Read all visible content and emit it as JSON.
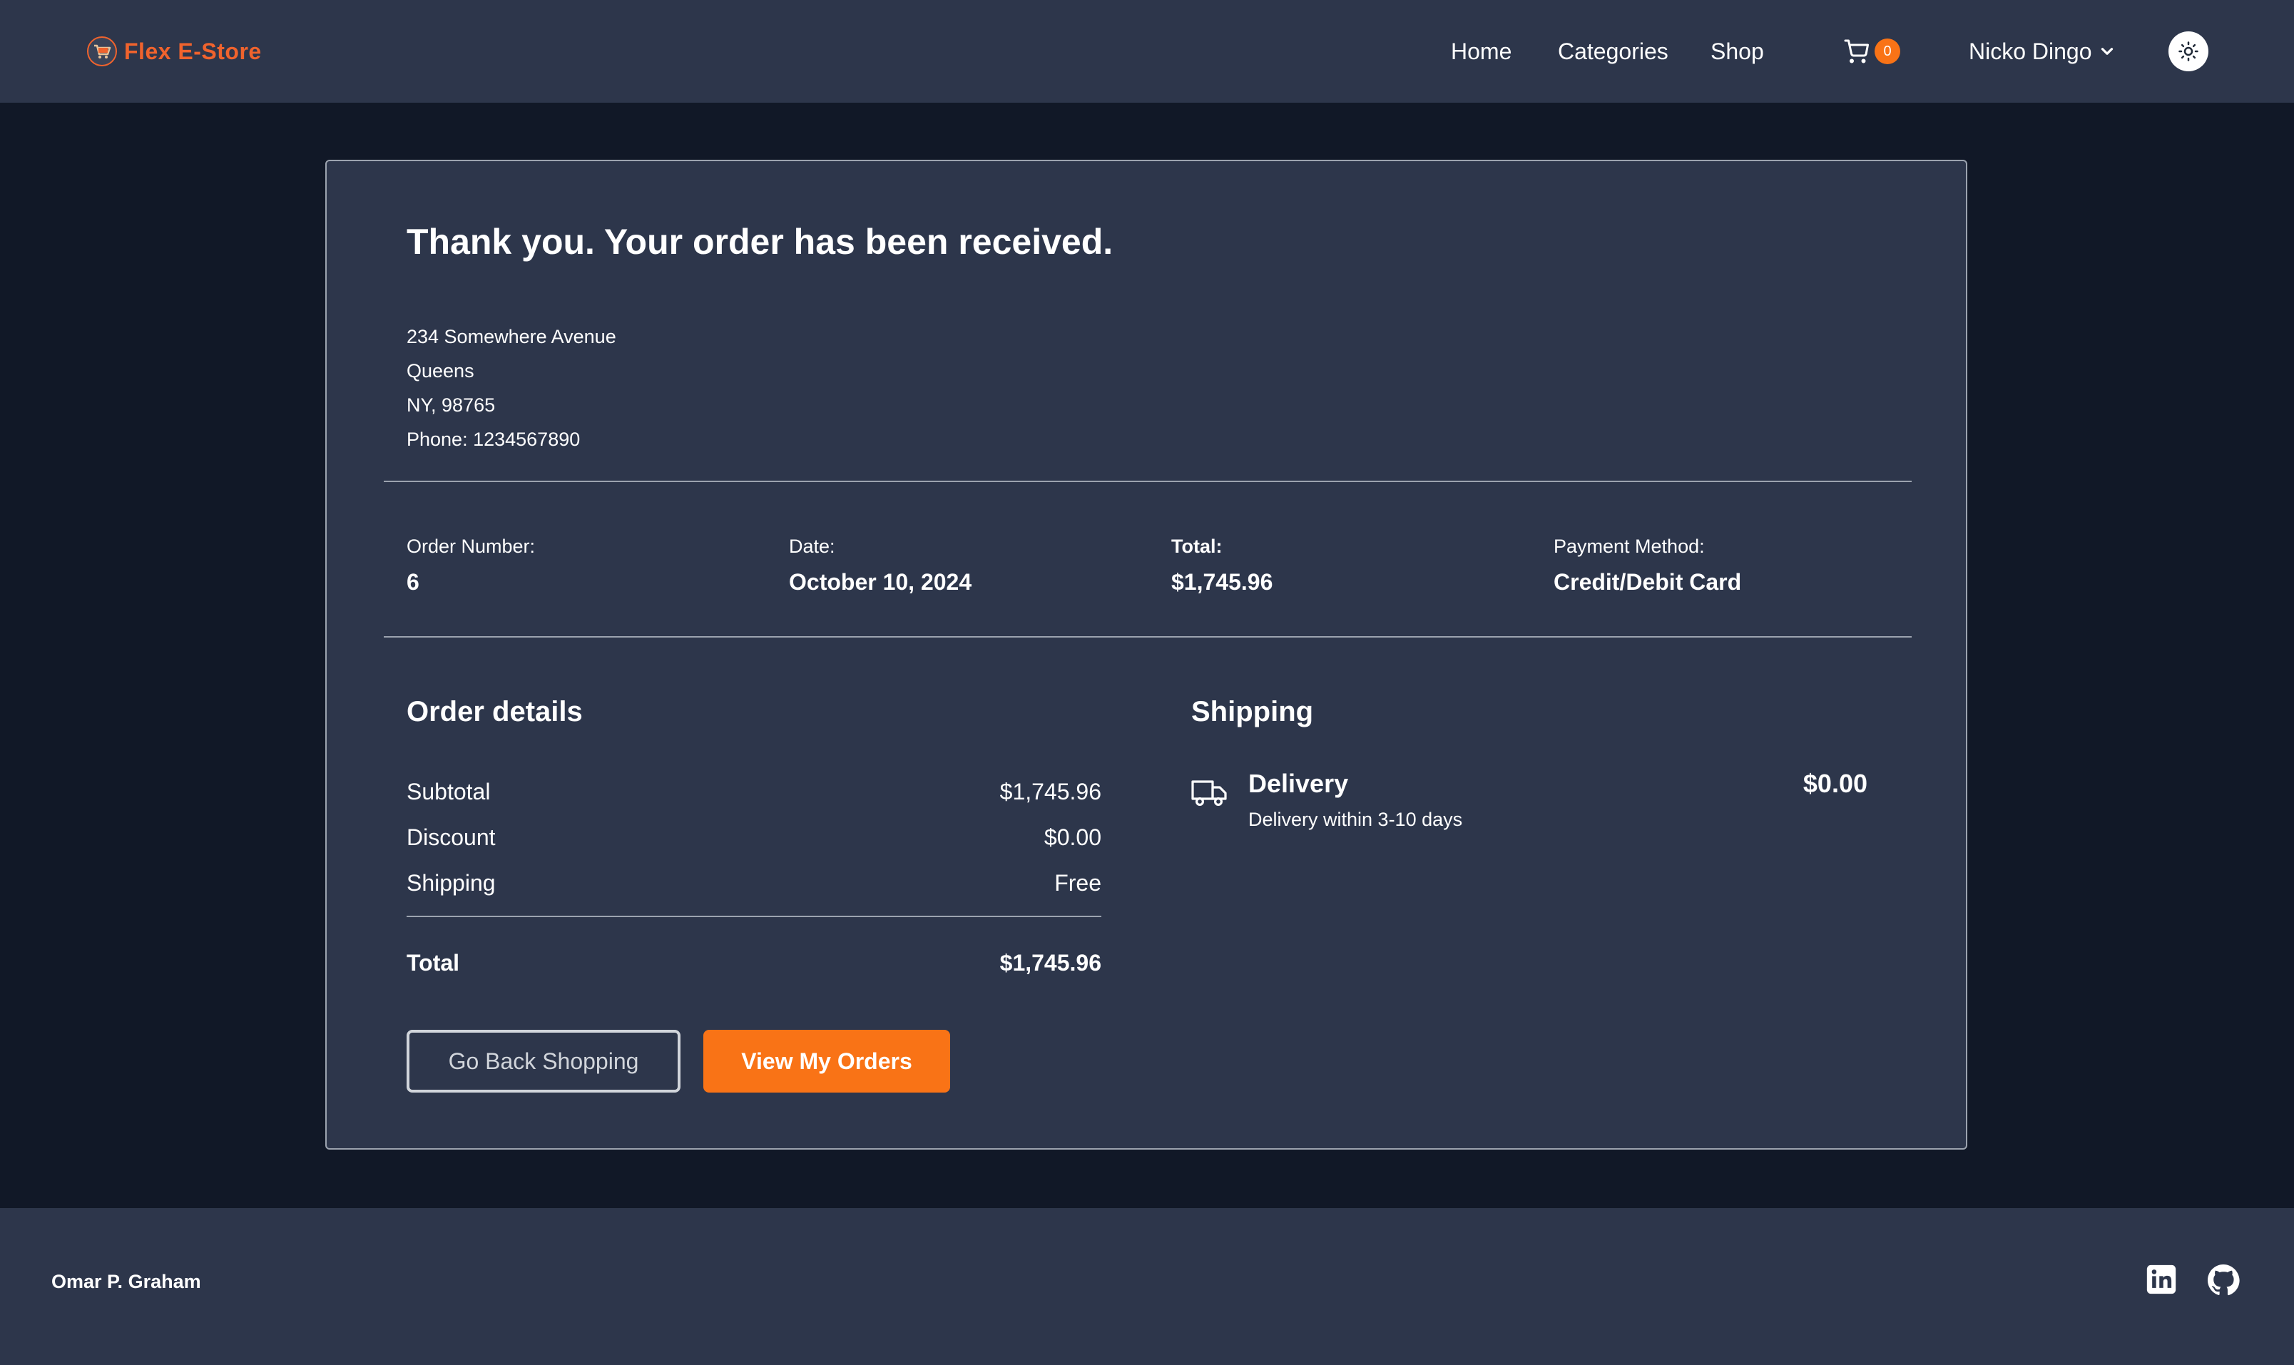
{
  "header": {
    "brand": "Flex E-Store",
    "nav": {
      "home": "Home",
      "categories": "Categories",
      "shop": "Shop"
    },
    "cart_count": "0",
    "user_name": "Nicko Dingo"
  },
  "confirmation": {
    "title": "Thank you. Your order has been received.",
    "address": {
      "line1": "234 Somewhere Avenue",
      "line2": "Queens",
      "line3": "NY, 98765",
      "phone": "Phone: 1234567890"
    },
    "meta": {
      "order_number_label": "Order Number:",
      "order_number": "6",
      "date_label": "Date:",
      "date": "October 10, 2024",
      "total_label": "Total:",
      "total": "$1,745.96",
      "payment_label": "Payment Method:",
      "payment": "Credit/Debit Card"
    }
  },
  "order_details": {
    "title": "Order details",
    "subtotal_label": "Subtotal",
    "subtotal": "$1,745.96",
    "discount_label": "Discount",
    "discount": "$0.00",
    "shipping_label": "Shipping",
    "shipping": "Free",
    "total_label": "Total",
    "total": "$1,745.96"
  },
  "buttons": {
    "back": "Go Back Shopping",
    "orders": "View My Orders"
  },
  "shipping": {
    "title": "Shipping",
    "method": "Delivery",
    "description": "Delivery within 3-10 days",
    "price": "$0.00"
  },
  "footer": {
    "author": "Omar P. Graham"
  },
  "colors": {
    "page_bg": "#111827",
    "panel_bg": "#2d364b",
    "accent": "#f97316",
    "brand": "#f0632d"
  },
  "icons": [
    "cart-logo-icon",
    "cart-icon",
    "chevron-down-icon",
    "sun-icon",
    "truck-icon",
    "linkedin-icon",
    "github-icon"
  ]
}
